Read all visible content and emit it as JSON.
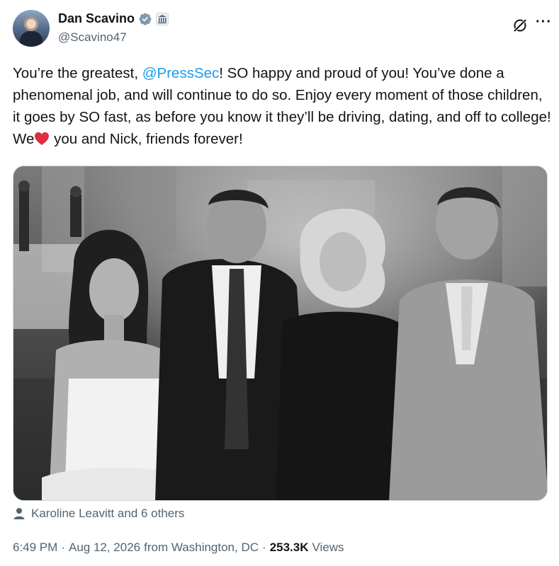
{
  "author": {
    "display_name": "Dan Scavino",
    "handle": "@Scavino47",
    "avatar_icon": "profile-photo",
    "verified_icon": "verified-badge-icon",
    "affiliation_icon": "government-building-icon"
  },
  "tweet": {
    "text_part1": "You’re the greatest, ",
    "mention": "@PressSec",
    "text_part2": "! SO happy and proud of you! You’ve done a phenomenal job, and will continue to do so. Enjoy every moment of those children, it goes by SO fast, as before you know it they’ll be driving, dating, and off to college! We",
    "heart_emoji": "❤️",
    "text_part3": " you and Nick, friends forever!"
  },
  "tagged": {
    "text": "Karoline Leavitt and 6 others",
    "icon": "person-icon"
  },
  "meta": {
    "time": "6:49 PM",
    "separator1": "·",
    "date": "Aug 12, 2026",
    "location": "from Washington, DC",
    "separator2": "·",
    "views_count": "253.3K",
    "views_label": "Views"
  },
  "colors": {
    "mention": "#1d9bf0",
    "secondary_text": "#536471",
    "primary_text": "#0f1419",
    "heart": "#e0245e"
  }
}
